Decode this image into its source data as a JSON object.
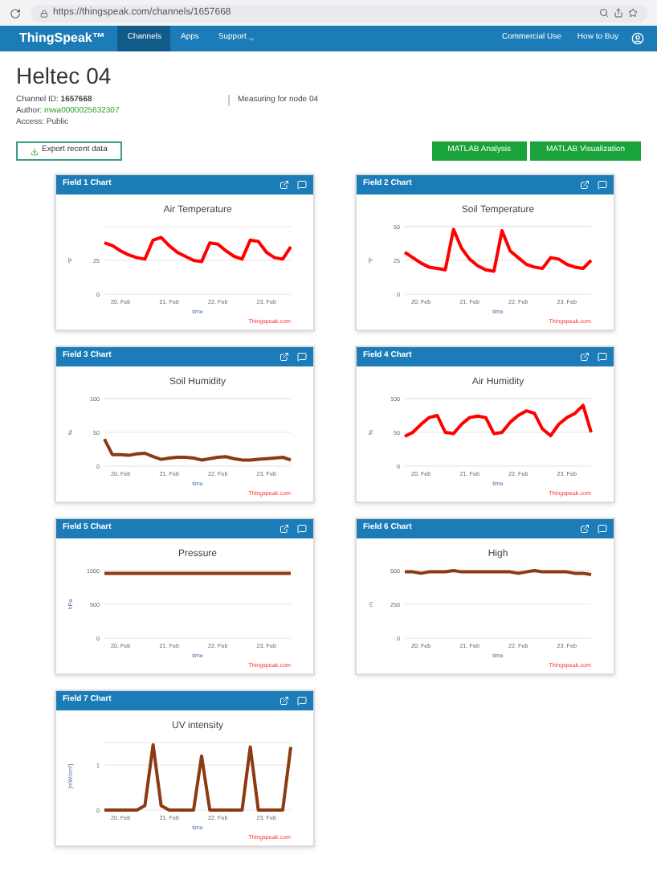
{
  "browser": {
    "url": "https://thingspeak.com/channels/1657668"
  },
  "nav": {
    "logo": "ThingSpeak™",
    "items": [
      {
        "label": "Channels",
        "selected": true,
        "dropdown": false
      },
      {
        "label": "Apps",
        "selected": false,
        "dropdown": false
      },
      {
        "label": "Support",
        "selected": false,
        "dropdown": true
      }
    ],
    "right_items": [
      "Commercial Use",
      "How to Buy"
    ]
  },
  "channel": {
    "title": "Heltec 04",
    "id_label": "Channel ID:",
    "id": "1657668",
    "author_label": "Author:",
    "author": "mwa0000025632307",
    "access": "Access: Public",
    "description": "Measuring for node 04"
  },
  "buttons": {
    "export": "Export recent data",
    "analysis": "MATLAB Analysis",
    "visualization": "MATLAB Visualization"
  },
  "charts": [
    {
      "header": "Field 1 Chart",
      "credit": "Thingspeak.com",
      "chart_data": {
        "type": "line",
        "title": "Air Temperature",
        "xlabel": "time",
        "ylabel": "°F",
        "categories": [
          null,
          null,
          "20. Feb",
          null,
          null,
          null,
          null,
          null,
          "21. Feb",
          null,
          null,
          null,
          null,
          null,
          "22. Feb",
          null,
          null,
          null,
          null,
          null,
          "23. Feb",
          null,
          null,
          null
        ],
        "ylim": [
          0,
          50
        ],
        "yticks": [
          0,
          25
        ],
        "series": [
          {
            "color": "#ff0000",
            "values": [
              38,
              36,
              32,
              29,
              27,
              26,
              40,
              42,
              36,
              31,
              28,
              25,
              24,
              38,
              37,
              32,
              28,
              26,
              40,
              39,
              31,
              27,
              26,
              35
            ]
          }
        ]
      }
    },
    {
      "header": "Field 2 Chart",
      "credit": "Thingspeak.com",
      "chart_data": {
        "type": "line",
        "title": "Soil Temperature",
        "xlabel": "time",
        "ylabel": "°F",
        "categories": [
          null,
          null,
          "20. Feb",
          null,
          null,
          null,
          null,
          null,
          "21. Feb",
          null,
          null,
          null,
          null,
          null,
          "22. Feb",
          null,
          null,
          null,
          null,
          null,
          "23. Feb",
          null,
          null,
          null
        ],
        "ylim": [
          0,
          50
        ],
        "yticks": [
          0,
          25,
          50
        ],
        "series": [
          {
            "color": "#ff0000",
            "values": [
              31,
              27,
              23,
              20,
              19,
              18,
              48,
              34,
              26,
              21,
              18,
              17,
              47,
              32,
              27,
              22,
              20,
              19,
              27,
              26,
              22,
              20,
              19,
              25
            ]
          }
        ]
      }
    },
    {
      "header": "Field 3 Chart",
      "credit": "Thingspeak.com",
      "chart_data": {
        "type": "line",
        "title": "Soil Humidity",
        "xlabel": "time",
        "ylabel": "%",
        "categories": [
          null,
          null,
          "20. Feb",
          null,
          null,
          null,
          null,
          null,
          "21. Feb",
          null,
          null,
          null,
          null,
          null,
          "22. Feb",
          null,
          null,
          null,
          null,
          null,
          "23. Feb",
          null,
          null,
          null
        ],
        "ylim": [
          0,
          100
        ],
        "yticks": [
          0,
          50,
          100
        ],
        "series": [
          {
            "color": "#8b3a12",
            "values": [
              40,
              17,
              17,
              16,
              18,
              19,
              14,
              10,
              12,
              13,
              13,
              12,
              9,
              11,
              13,
              14,
              11,
              9,
              9,
              10,
              11,
              12,
              13,
              9
            ]
          }
        ]
      }
    },
    {
      "header": "Field 4 Chart",
      "credit": "Thingspeak.com",
      "chart_data": {
        "type": "line",
        "title": "Air Humidity",
        "xlabel": "time",
        "ylabel": "%",
        "categories": [
          null,
          null,
          "20. Feb",
          null,
          null,
          null,
          null,
          null,
          "21. Feb",
          null,
          null,
          null,
          null,
          null,
          "22. Feb",
          null,
          null,
          null,
          null,
          null,
          "23. Feb",
          null,
          null,
          null
        ],
        "ylim": [
          0,
          100
        ],
        "yticks": [
          0,
          50,
          100
        ],
        "series": [
          {
            "color": "#ff0000",
            "values": [
              44,
              50,
              62,
              72,
              75,
              50,
              48,
              62,
              72,
              74,
              72,
              48,
              50,
              65,
              75,
              82,
              78,
              55,
              45,
              62,
              72,
              78,
              90,
              50
            ]
          }
        ]
      }
    },
    {
      "header": "Field 5 Chart",
      "credit": "Thingspeak.com",
      "chart_data": {
        "type": "line",
        "title": "Pressure",
        "xlabel": "time",
        "ylabel": "hPa",
        "categories": [
          null,
          null,
          "20. Feb",
          null,
          null,
          null,
          null,
          null,
          "21. Feb",
          null,
          null,
          null,
          null,
          null,
          "22. Feb",
          null,
          null,
          null,
          null,
          null,
          "23. Feb",
          null,
          null,
          null
        ],
        "ylim": [
          0,
          1000
        ],
        "yticks": [
          0,
          500,
          1000
        ],
        "series": [
          {
            "color": "#8b3a12",
            "values": [
              960,
              960,
              960,
              960,
              960,
              960,
              960,
              960,
              960,
              960,
              960,
              960,
              960,
              960,
              960,
              960,
              960,
              960,
              960,
              960,
              960,
              960,
              960,
              960
            ]
          }
        ]
      }
    },
    {
      "header": "Field 6 Chart",
      "credit": "Thingspeak.com",
      "chart_data": {
        "type": "line",
        "title": "High",
        "xlabel": "time",
        "ylabel": "m",
        "categories": [
          null,
          null,
          "20. Feb",
          null,
          null,
          null,
          null,
          null,
          "21. Feb",
          null,
          null,
          null,
          null,
          null,
          "22. Feb",
          null,
          null,
          null,
          null,
          null,
          "23. Feb",
          null,
          null,
          null
        ],
        "ylim": [
          0,
          500
        ],
        "yticks": [
          0,
          250,
          500
        ],
        "series": [
          {
            "color": "#8b3a12",
            "values": [
              490,
              490,
              480,
              490,
              490,
              490,
              500,
              490,
              490,
              490,
              490,
              490,
              490,
              490,
              480,
              490,
              500,
              490,
              490,
              490,
              490,
              480,
              480,
              470
            ]
          }
        ]
      }
    },
    {
      "header": "Field 7 Chart",
      "credit": "Thingspeak.com",
      "chart_data": {
        "type": "line",
        "title": "UV intensity",
        "xlabel": "time",
        "ylabel": "[mW/cm²]",
        "categories": [
          null,
          null,
          "20. Feb",
          null,
          null,
          null,
          null,
          null,
          "21. Feb",
          null,
          null,
          null,
          null,
          null,
          "22. Feb",
          null,
          null,
          null,
          null,
          null,
          "23. Feb",
          null,
          null,
          null
        ],
        "ylim": [
          0,
          1.5
        ],
        "yticks": [
          0,
          1
        ],
        "series": [
          {
            "color": "#8b3a12",
            "values": [
              0,
              0,
              0,
              0,
              0,
              0.1,
              1.45,
              0.1,
              0,
              0,
              0,
              0,
              1.2,
              0,
              0,
              0,
              0,
              0,
              1.4,
              0,
              0,
              0,
              0,
              1.4
            ]
          }
        ]
      }
    }
  ]
}
